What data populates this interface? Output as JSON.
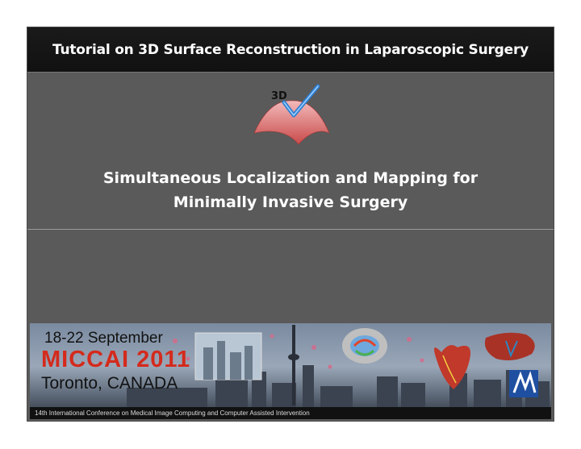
{
  "slide": {
    "header_title": "Tutorial on 3D Surface Reconstruction in Laparoscopic Surgery",
    "logo_text": "3D",
    "subtitle_line1": "Simultaneous Localization and Mapping for",
    "subtitle_line2": "Minimally Invasive Surgery"
  },
  "banner": {
    "date": "18-22 September",
    "conference": "MICCAI 2011",
    "city": "Toronto, CANADA",
    "footer": "14th International Conference on Medical Image Computing and Computer Assisted Intervention"
  },
  "colors": {
    "slide_background": "#5a5a5a",
    "header_background": "#111111",
    "conference_red": "#d42a1c"
  },
  "icons": {
    "logo": "3d-surface-checkmark-icon"
  }
}
